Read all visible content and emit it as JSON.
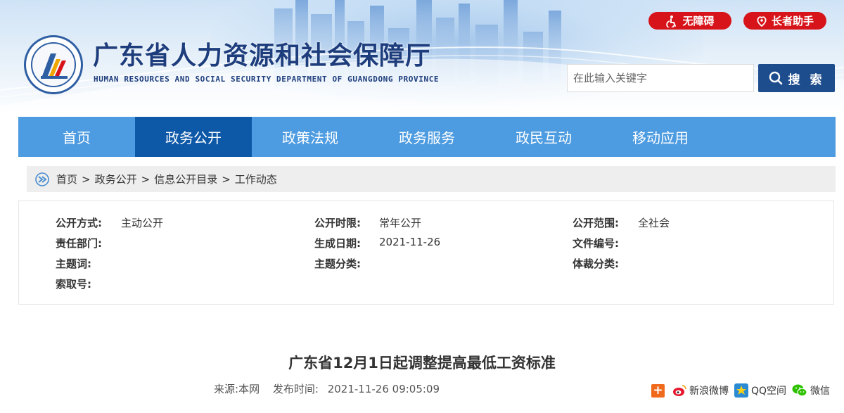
{
  "header": {
    "title": "广东省人力资源和社会保障厅",
    "subtitle": "HUMAN RESOURCES AND SOCIAL SECURITY DEPARTMENT OF GUANGDONG PROVINCE",
    "accessibility_label": "无障碍",
    "elder_label": "长者助手",
    "search_placeholder": "在此输入关键字",
    "search_button": "搜 索"
  },
  "nav": {
    "items": [
      {
        "label": "首页"
      },
      {
        "label": "政务公开"
      },
      {
        "label": "政策法规"
      },
      {
        "label": "政务服务"
      },
      {
        "label": "政民互动"
      },
      {
        "label": "移动应用"
      }
    ],
    "active_index": 1
  },
  "breadcrumb": {
    "items": [
      "首页",
      "政务公开",
      "信息公开目录",
      "工作动态"
    ],
    "separator": ">"
  },
  "info": {
    "open_method_label": "公开方式:",
    "open_method_value": "主动公开",
    "open_period_label": "公开时限:",
    "open_period_value": "常年公开",
    "open_scope_label": "公开范围:",
    "open_scope_value": "全社会",
    "department_label": "责任部门:",
    "date_label": "生成日期:",
    "date_value": "2021-11-26",
    "doc_number_label": "文件编号:",
    "keywords_label": "主题词:",
    "category_label": "主题分类:",
    "genre_label": "体裁分类:",
    "index_label": "索取号:"
  },
  "article": {
    "title": "广东省12月1日起调整提高最低工资标准",
    "source_label": "来源:",
    "source_value": "本网",
    "publish_label": "发布时间:",
    "publish_value": "2021-11-26 09:05:09"
  },
  "share": {
    "plus": "+",
    "weibo": "新浪微博",
    "qzone": "QQ空间",
    "wechat": "微信"
  },
  "colors": {
    "nav_bg": "#4d9be0",
    "nav_active": "#0e58a8",
    "title_blue": "#1d3d7c",
    "pill_red": "#d7141a",
    "search_blue": "#1e4d8e"
  }
}
